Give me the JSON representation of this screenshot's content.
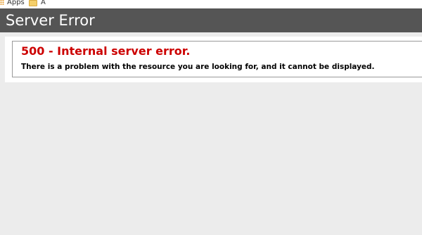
{
  "bookmarks": {
    "items": [
      {
        "label": "Apps",
        "icon": "apps-grid-icon"
      },
      {
        "label": "A",
        "icon": "folder-icon"
      }
    ]
  },
  "header": {
    "title": "Server Error"
  },
  "error": {
    "title": "500 - Internal server error.",
    "description": "There is a problem with the resource you are looking for, and it cannot be displayed.",
    "title_color": "#cc0000"
  },
  "colors": {
    "header_bg": "#555555",
    "page_bg": "#ececec"
  }
}
